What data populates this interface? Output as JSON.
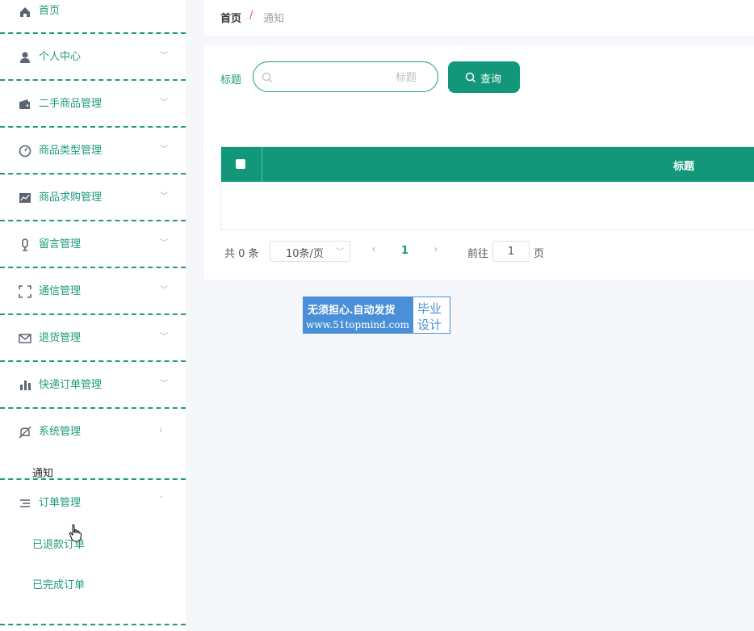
{
  "sidebar": {
    "items": [
      {
        "label": "首页",
        "icon": "home-icon"
      },
      {
        "label": "个人中心",
        "icon": "user-icon"
      },
      {
        "label": "二手商品管理",
        "icon": "wallet-icon"
      },
      {
        "label": "商品类型管理",
        "icon": "gauge-icon"
      },
      {
        "label": "商品求购管理",
        "icon": "trend-chart-icon"
      },
      {
        "label": "留言管理",
        "icon": "microphone-icon"
      },
      {
        "label": "通信管理",
        "icon": "fullscreen-icon"
      },
      {
        "label": "退货管理",
        "icon": "mail-icon"
      },
      {
        "label": "快递订单管理",
        "icon": "bar-chart-icon"
      },
      {
        "label": "系统管理",
        "icon": "bell-off-icon"
      },
      {
        "label": "订单管理",
        "icon": "list-icon"
      }
    ],
    "system_sub": [
      "通知"
    ],
    "order_sub": [
      "已退款订单",
      "已完成订单"
    ]
  },
  "breadcrumb": {
    "home": "首页",
    "separator": "/",
    "current": "通知"
  },
  "search": {
    "label": "标题",
    "placeholder": "标题",
    "button_label": "查询"
  },
  "table": {
    "header_title": "标题"
  },
  "pagination": {
    "total": "共 0 条",
    "page_size": "10条/页",
    "current_page": "1",
    "goto_label": "前往",
    "goto_value": "1",
    "suffix": "页"
  },
  "watermark": {
    "line1": "无须担心.自动发货",
    "line2": "www.51topmind.com",
    "right_top": "毕业",
    "right_bottom": "设计"
  },
  "colors": {
    "accent": "#12977a",
    "sidebar_text": "#1e9b7d",
    "breadcrumb_sep": "#e0553b",
    "watermark_blue": "#4a90d9"
  }
}
